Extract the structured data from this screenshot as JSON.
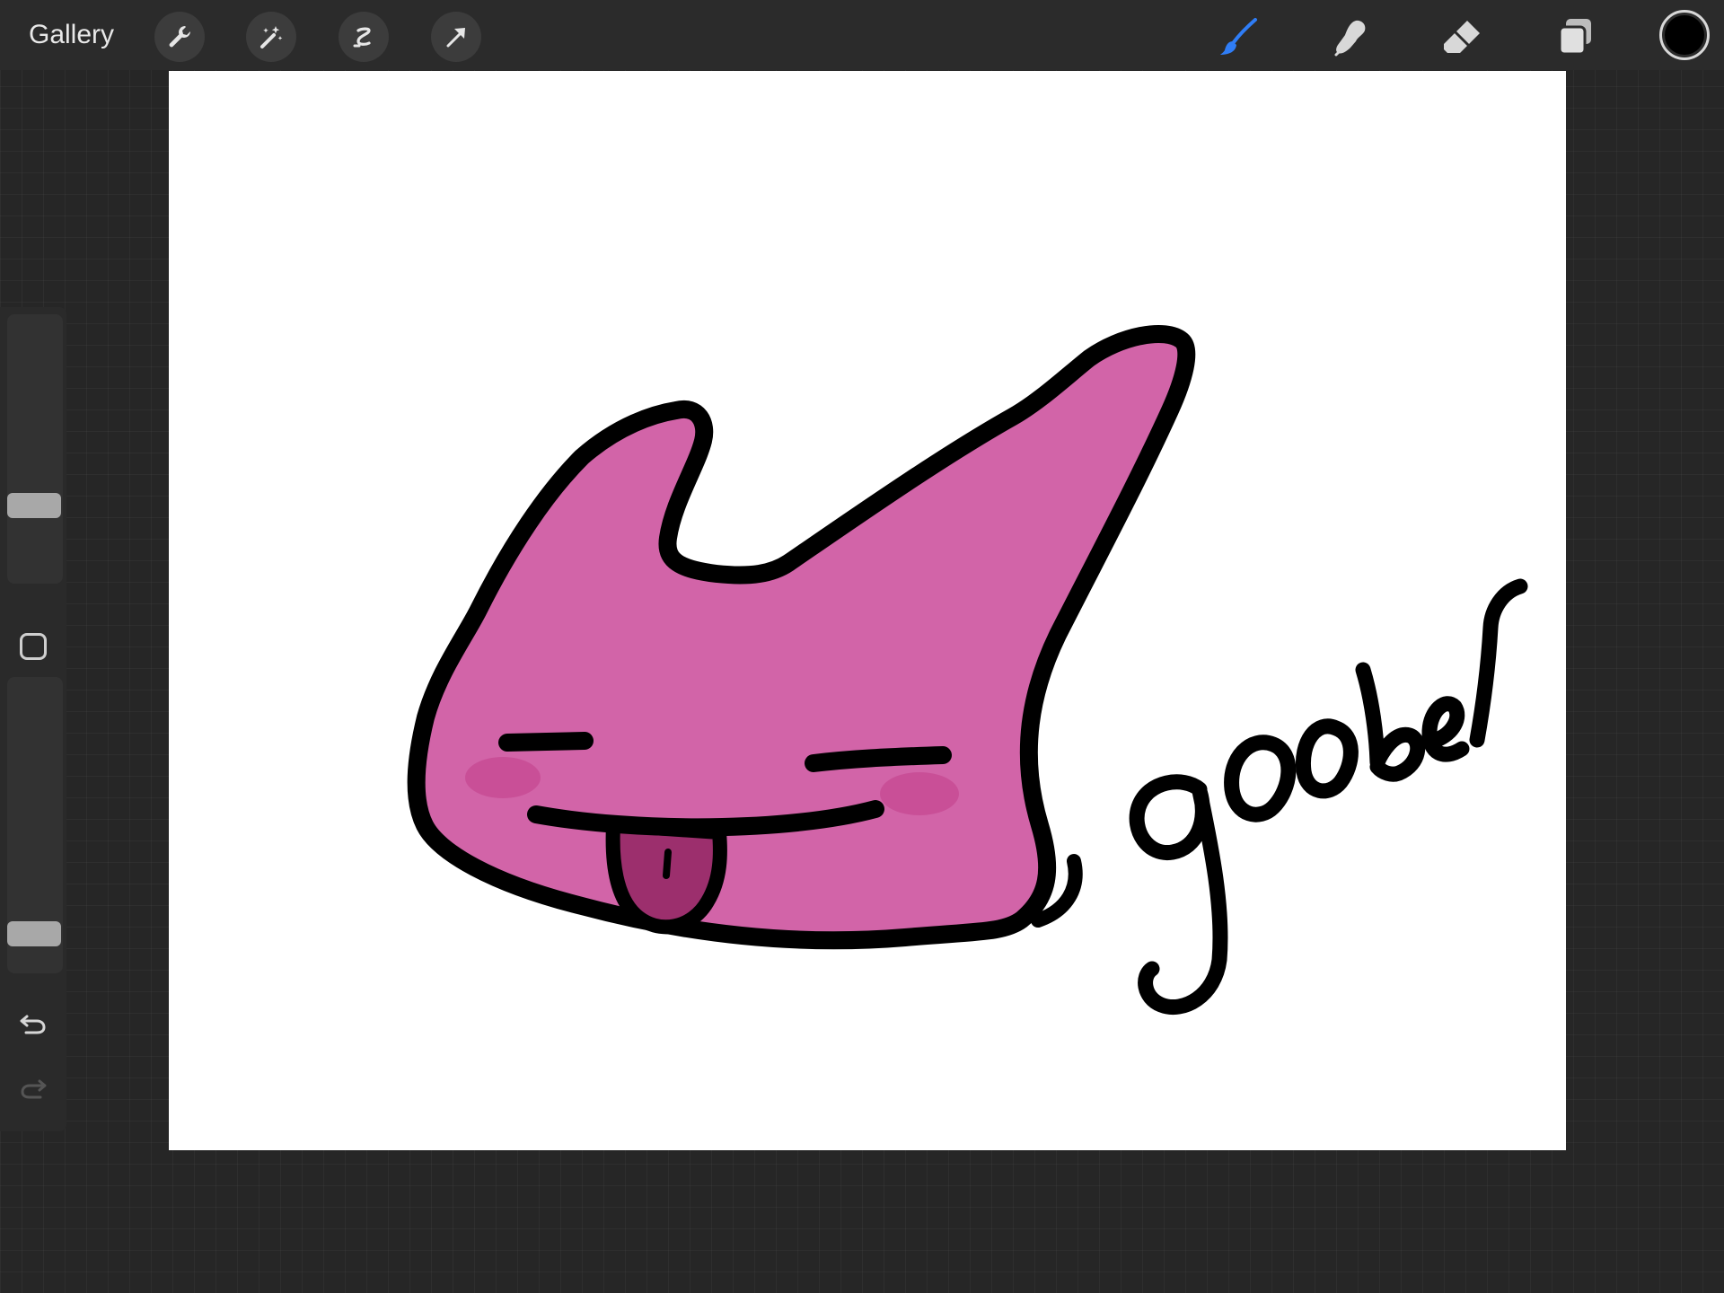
{
  "topbar": {
    "gallery_label": "Gallery",
    "left_tools": [
      {
        "name": "actions",
        "icon": "wrench-icon"
      },
      {
        "name": "adjustments",
        "icon": "magic-wand-icon"
      },
      {
        "name": "selection",
        "icon": "selection-s-icon"
      },
      {
        "name": "transform",
        "icon": "transform-arrow-icon"
      }
    ],
    "right_tools": [
      {
        "name": "brush",
        "icon": "brush-icon",
        "active": true
      },
      {
        "name": "smudge",
        "icon": "smudge-finger-icon",
        "active": false
      },
      {
        "name": "eraser",
        "icon": "eraser-icon",
        "active": false
      },
      {
        "name": "layers",
        "icon": "layers-icon",
        "active": false
      }
    ],
    "current_color": "#000000",
    "active_tool_color": "#2f7df6"
  },
  "sidebar": {
    "brush_size_level": 0.27,
    "brush_opacity_level": 0.1,
    "undo_icon": "undo-icon",
    "redo_icon": "redo-icon"
  },
  "canvas": {
    "background": "#ffffff",
    "creature_fill": "#d264a8",
    "blush_color": "#c94f97",
    "tongue_color": "#9c2f6d",
    "handwritten_text": "goober"
  }
}
